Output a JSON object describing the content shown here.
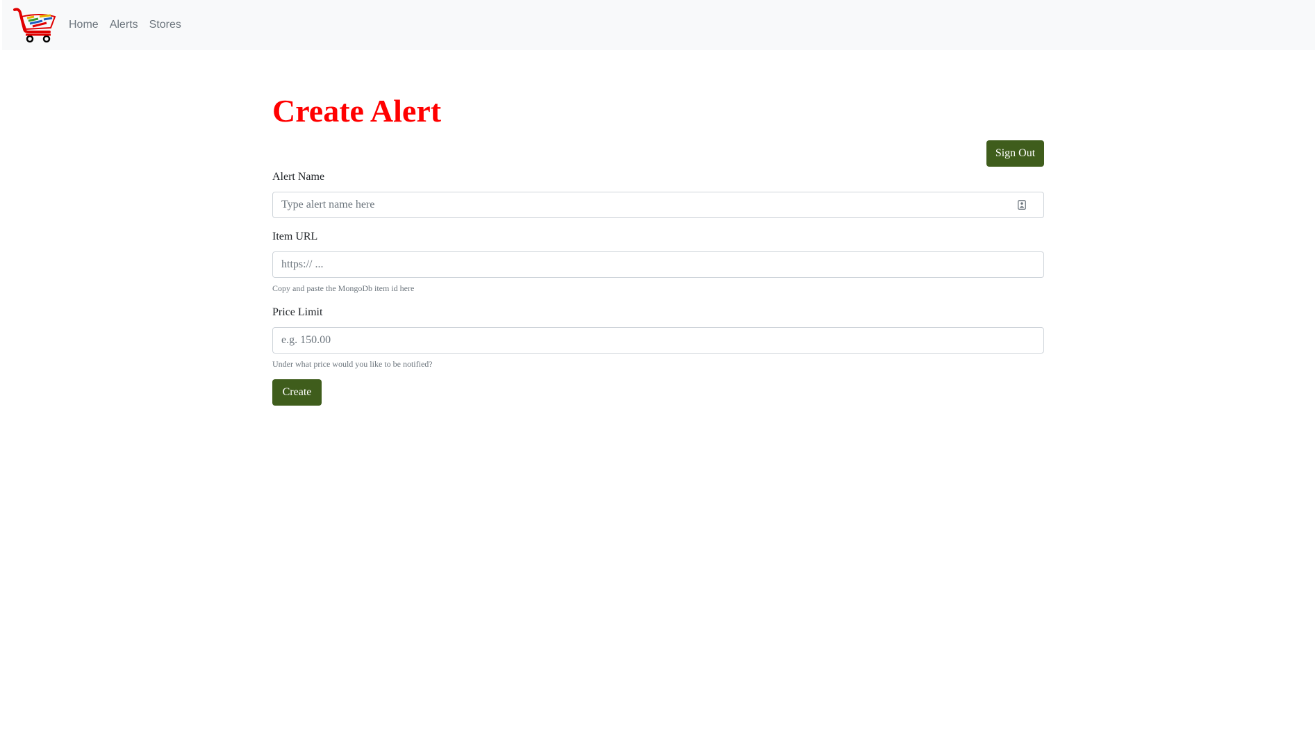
{
  "navbar": {
    "logo": "shopping-cart-logo",
    "links": [
      {
        "label": "Home"
      },
      {
        "label": "Alerts"
      },
      {
        "label": "Stores"
      }
    ]
  },
  "page": {
    "title": "Create Alert",
    "title_color": "#ff0000"
  },
  "actions": {
    "sign_out_label": "Sign Out",
    "button_color": "#3f5d1c"
  },
  "form": {
    "alert_name": {
      "label": "Alert Name",
      "placeholder": "Type alert name here",
      "value": ""
    },
    "item_url": {
      "label": "Item URL",
      "placeholder": "https:// ...",
      "value": "",
      "help": "Copy and paste the MongoDb item id here"
    },
    "price_limit": {
      "label": "Price Limit",
      "placeholder": "e.g. 150.00",
      "value": "",
      "help": "Under what price would you like to be notified?"
    },
    "submit_label": "Create"
  }
}
